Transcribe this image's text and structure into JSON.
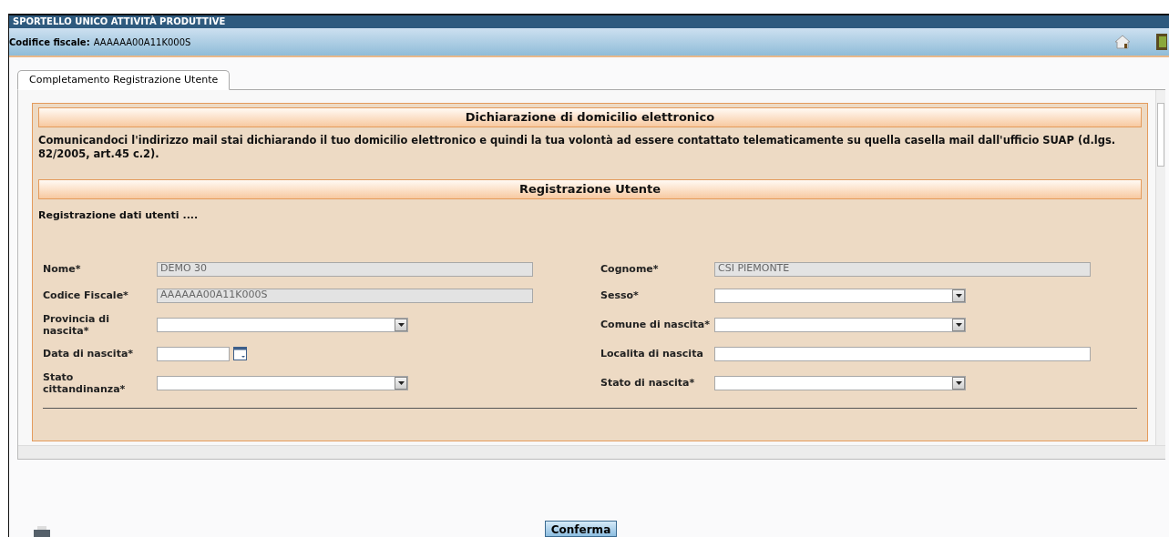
{
  "header": {
    "title": "SPORTELLO UNICO ATTIVITÀ PRODUTTIVE",
    "fiscal_label": "Codifice fiscale:",
    "fiscal_value": "AAAAAA00A11K000S"
  },
  "tabs": [
    {
      "label": "Completamento Registrazione Utente",
      "selected": true
    }
  ],
  "sections": [
    {
      "title": "Dichiarazione di domicilio elettronico",
      "text": "Comunicandoci l'indirizzo mail stai dichiarando il tuo domicilio elettronico e quindi la tua volontà ad essere contattato telematicamente su quella casella mail dall'ufficio SUAP (d.lgs. 82/2005, art.45 c.2)."
    },
    {
      "title": "Registrazione Utente",
      "text": "Registrazione dati utenti ...."
    }
  ],
  "rows": [
    {
      "left": {
        "label": "Nome*",
        "kind": "text",
        "value": "DEMO 30",
        "disabled": true
      },
      "right": {
        "label": "Cognome*",
        "kind": "text",
        "value": "CSI PIEMONTE",
        "disabled": true
      }
    },
    {
      "left": {
        "label": "Codice Fiscale*",
        "kind": "text",
        "value": "AAAAAA00A11K000S",
        "disabled": true
      },
      "right": {
        "label": "Sesso*",
        "kind": "select",
        "disabled": false
      }
    },
    {
      "left": {
        "label": "Provincia di nascita*",
        "kind": "select",
        "disabled": false
      },
      "right": {
        "label": "Comune di nascita*",
        "kind": "select",
        "disabled": false
      }
    },
    {
      "left": {
        "label": "Data di nascita*",
        "kind": "date",
        "disabled": false
      },
      "right": {
        "label": "Localita di nascita",
        "kind": "text",
        "disabled": false
      }
    },
    {
      "left": {
        "label": "Stato cittandinanza*",
        "kind": "select",
        "disabled": false
      },
      "right": {
        "label": "Stato di nascita*",
        "kind": "select",
        "disabled": false
      }
    }
  ],
  "confirm_button": "Conferma"
}
